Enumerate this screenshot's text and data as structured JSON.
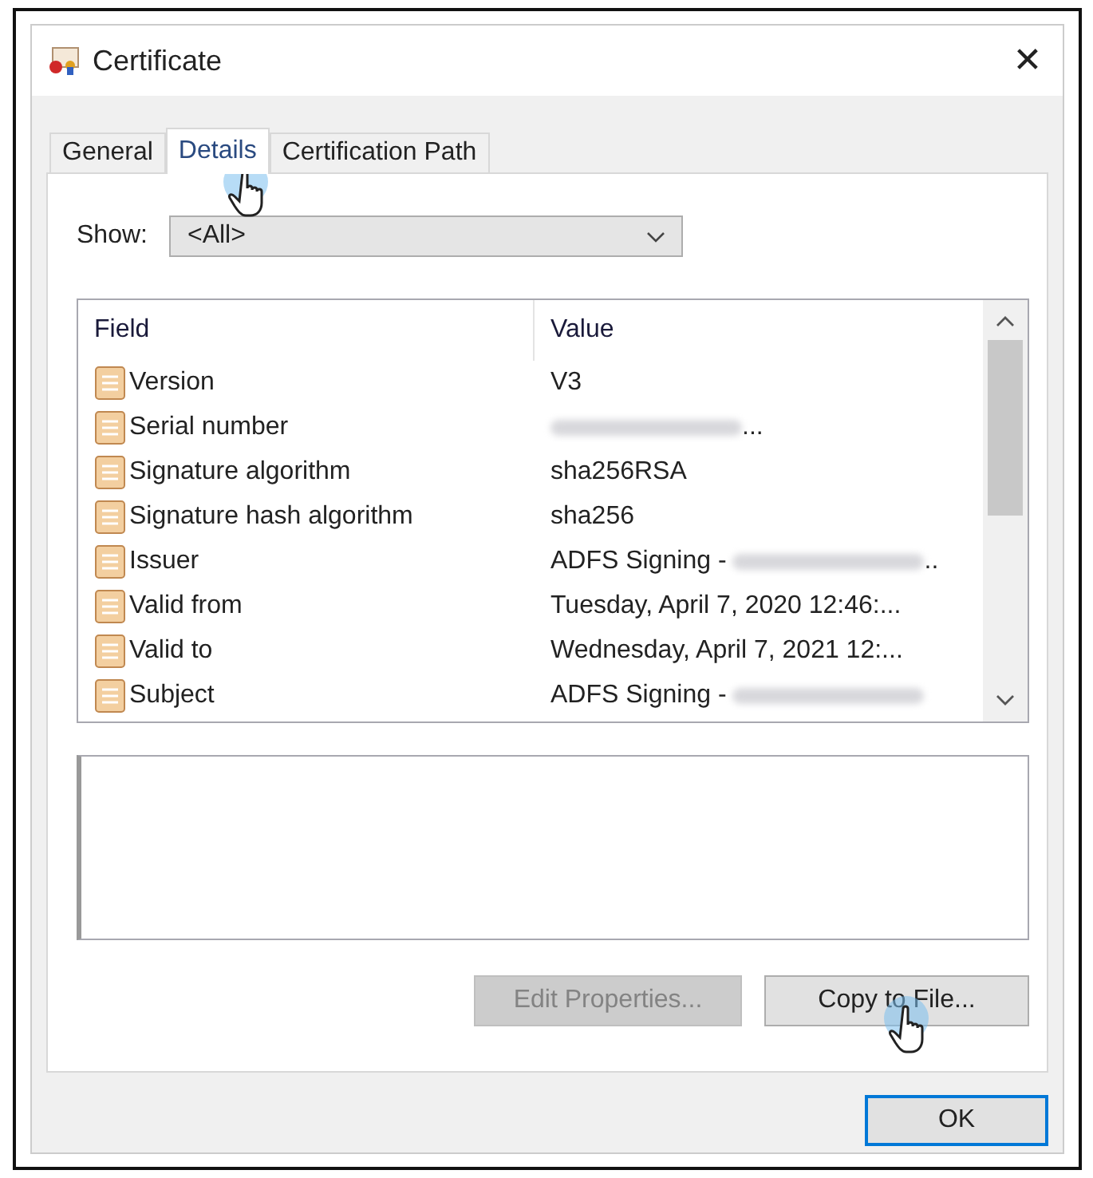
{
  "window": {
    "title": "Certificate",
    "close": "✕"
  },
  "tabs": [
    {
      "label": "General",
      "selected": false
    },
    {
      "label": "Details",
      "selected": true
    },
    {
      "label": "Certification Path",
      "selected": false
    }
  ],
  "show": {
    "label": "Show:",
    "value": "<All>"
  },
  "table": {
    "columns": [
      "Field",
      "Value"
    ],
    "rows": [
      {
        "field": "Version",
        "value": "V3",
        "redacted": false,
        "tail": ""
      },
      {
        "field": "Serial number",
        "value": "",
        "redacted": true,
        "tail": "..."
      },
      {
        "field": "Signature algorithm",
        "value": "sha256RSA",
        "redacted": false,
        "tail": ""
      },
      {
        "field": "Signature hash algorithm",
        "value": "sha256",
        "redacted": false,
        "tail": ""
      },
      {
        "field": "Issuer",
        "value": "ADFS Signing -",
        "redacted": true,
        "tail": ".."
      },
      {
        "field": "Valid from",
        "value": "Tuesday, April 7, 2020 12:46:...",
        "redacted": false,
        "tail": ""
      },
      {
        "field": "Valid to",
        "value": "Wednesday, April 7, 2021 12:...",
        "redacted": false,
        "tail": ""
      },
      {
        "field": "Subject",
        "value": "ADFS Signing -",
        "redacted": true,
        "tail": ""
      }
    ]
  },
  "buttons": [
    {
      "label": "Edit Properties...",
      "disabled": true
    },
    {
      "label": "Copy to File...",
      "disabled": false
    }
  ],
  "ok": {
    "label": "OK"
  }
}
